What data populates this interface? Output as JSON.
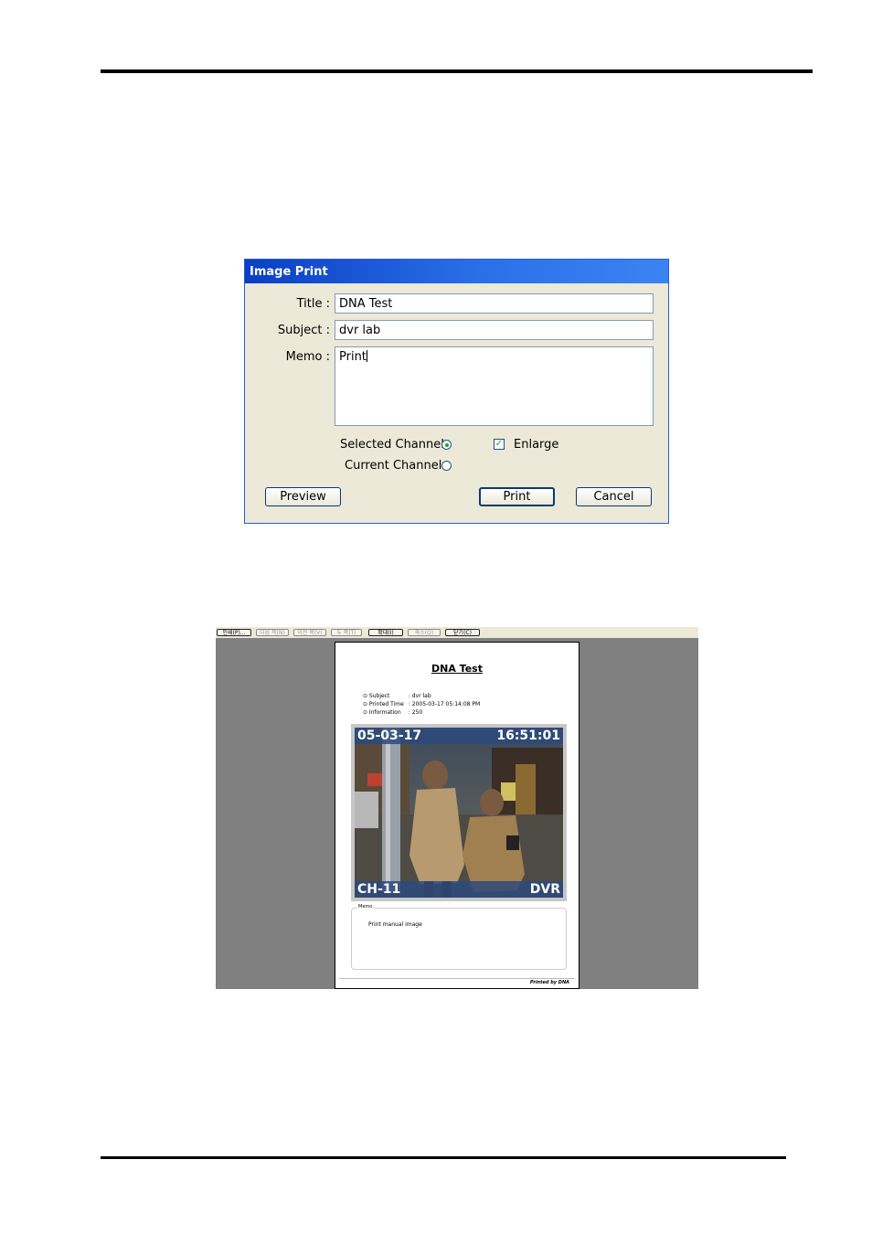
{
  "dialog": {
    "title": "Image Print",
    "labels": {
      "title": "Title :",
      "subject": "Subject :",
      "memo": "Memo :"
    },
    "values": {
      "title": "DNA Test",
      "subject": "dvr lab",
      "memo": "Print"
    },
    "options": {
      "selected_channel": "Selected Channel",
      "current_channels": "Current Channels",
      "enlarge": "Enlarge",
      "selected_channel_checked": true,
      "current_channels_checked": false,
      "enlarge_checked": true
    },
    "buttons": {
      "preview": "Preview",
      "print": "Print",
      "cancel": "Cancel"
    }
  },
  "print_preview": {
    "toolbar_buttons": [
      "인쇄(P)...",
      "다음 쪽(N)",
      "이전 쪽(V)",
      "두 쪽(T)",
      "확대(I)",
      "축소(O)",
      "닫기(C)"
    ],
    "page": {
      "title": "DNA Test",
      "info": [
        {
          "key": "Subject",
          "value": ": dvr lab"
        },
        {
          "key": "Printed Time",
          "value": ": 2005-03-17   05:14:08 PM"
        },
        {
          "key": "Information",
          "value": ": 250"
        }
      ],
      "camera_overlay": {
        "date": "05-03-17",
        "time": "16:51:01",
        "channel": "CH-11",
        "brand": "DVR"
      },
      "memo_label": "Memo",
      "memo_text": "Print manual image",
      "footer": "Printed by DNA"
    }
  }
}
